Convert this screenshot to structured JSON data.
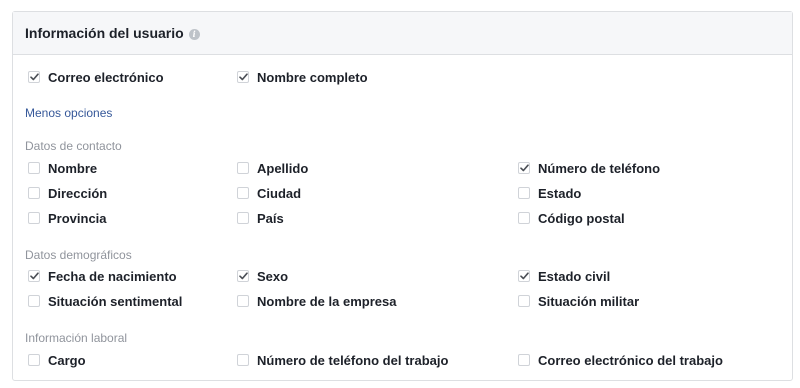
{
  "header": {
    "title": "Información del usuario",
    "info_icon": "info-icon"
  },
  "top_options": [
    {
      "label": "Correo electrónico",
      "checked": true
    },
    {
      "label": "Nombre completo",
      "checked": true
    }
  ],
  "less_options_link": "Menos opciones",
  "sections": [
    {
      "title": "Datos de contacto",
      "rows": [
        [
          {
            "label": "Nombre",
            "checked": false
          },
          {
            "label": "Apellido",
            "checked": false
          },
          {
            "label": "Número de teléfono",
            "checked": true
          }
        ],
        [
          {
            "label": "Dirección",
            "checked": false
          },
          {
            "label": "Ciudad",
            "checked": false
          },
          {
            "label": "Estado",
            "checked": false
          }
        ],
        [
          {
            "label": "Provincia",
            "checked": false
          },
          {
            "label": "País",
            "checked": false
          },
          {
            "label": "Código postal",
            "checked": false
          }
        ]
      ]
    },
    {
      "title": "Datos demográficos",
      "rows": [
        [
          {
            "label": "Fecha de nacimiento",
            "checked": true
          },
          {
            "label": "Sexo",
            "checked": true
          },
          {
            "label": "Estado civil",
            "checked": true
          }
        ],
        [
          {
            "label": "Situación sentimental",
            "checked": false
          },
          {
            "label": "Nombre de la empresa",
            "checked": false
          },
          {
            "label": "Situación militar",
            "checked": false
          }
        ]
      ]
    },
    {
      "title": "Información laboral",
      "rows": [
        [
          {
            "label": "Cargo",
            "checked": false
          },
          {
            "label": "Número de teléfono del trabajo",
            "checked": false
          },
          {
            "label": "Correo electrónico del trabajo",
            "checked": false
          }
        ]
      ]
    }
  ],
  "colors": {
    "header_bg": "#f6f7f9",
    "border": "#dddfe2",
    "link": "#365899",
    "section_title": "#90949c",
    "text": "#1d2129"
  }
}
